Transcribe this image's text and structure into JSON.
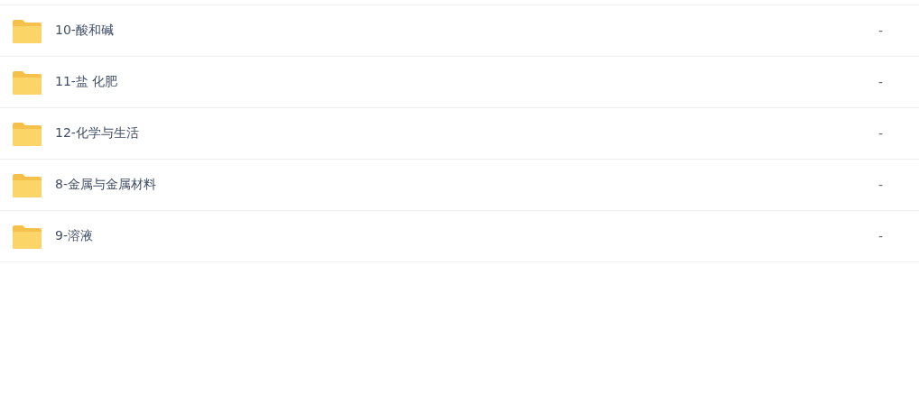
{
  "files": [
    {
      "name": "10-酸和碱",
      "size": "-"
    },
    {
      "name": "11-盐 化肥",
      "size": "-"
    },
    {
      "name": "12-化学与生活",
      "size": "-"
    },
    {
      "name": "8-金属与金属材料",
      "size": "-"
    },
    {
      "name": "9-溶液",
      "size": "-"
    }
  ]
}
